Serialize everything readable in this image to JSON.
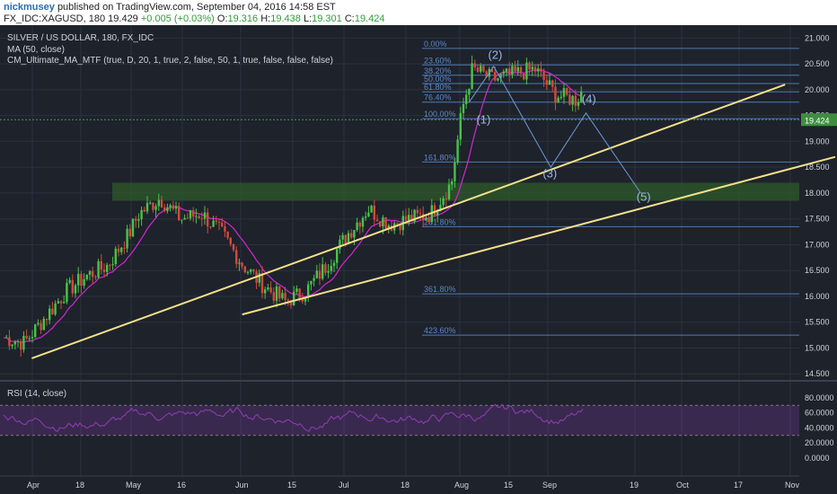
{
  "header": {
    "username": "nickmusey",
    "published": "published on TradingView.com, September 04, 2016 14:58 EST",
    "symbol": "FX_IDC:XAGUSD, 180",
    "last": "19.429",
    "change": "+0.005 (+0.03%)",
    "open_label": "O:",
    "open": "19.316",
    "high_label": "H:",
    "high": "19.438",
    "low_label": "L:",
    "low": "19.301",
    "close_label": "C:",
    "close": "19.424"
  },
  "legend": {
    "title": "SILVER / US DOLLAR, 180, FX_IDC",
    "ma": "MA (50, close)",
    "cm": "CM_Ultimate_MA_MTF (true, D, 20, 1, true, 2, false, 50, 1, true, false, false, false)",
    "rsi": "RSI (14, close)"
  },
  "colors": {
    "background": "#1e222b",
    "grid": "#2b3140",
    "candle_up": "#49c249",
    "candle_down": "#d24a3c",
    "ma": "#d028d0",
    "fib": "#5b89c7",
    "trendline": "#f3e08a",
    "support_zone": "#2d5a2a",
    "rsi": "#8e3fb8",
    "price_badge": "#3d8f3f"
  },
  "chart_data": {
    "type": "candlestick",
    "x_ticks": [
      "Apr",
      "18",
      "May",
      "16",
      "Jun",
      "15",
      "Jul",
      "18",
      "Aug",
      "15",
      "Sep",
      "19",
      "Oct",
      "17",
      "Nov"
    ],
    "y_ticks": [
      "21.000",
      "20.500",
      "20.000",
      "19.500",
      "19.000",
      "18.500",
      "18.000",
      "17.500",
      "17.000",
      "16.500",
      "16.000",
      "15.500",
      "15.000",
      "14.500"
    ],
    "ylim": [
      14.4,
      21.25
    ],
    "current_price": "19.424",
    "rsi_ticks": [
      "80.0000",
      "60.0000",
      "40.0000",
      "20.0000",
      "0.0000"
    ],
    "rsi_range": [
      0,
      100
    ],
    "rsi_bands": [
      70,
      30
    ],
    "support_zone": [
      17.85,
      18.2
    ],
    "price_path": [
      [
        0,
        15.2
      ],
      [
        2,
        15.1
      ],
      [
        4,
        15.6
      ],
      [
        6,
        16.1
      ],
      [
        8,
        16.4
      ],
      [
        10,
        16.6
      ],
      [
        12,
        17.2
      ],
      [
        13,
        17.6
      ],
      [
        15,
        17.9
      ],
      [
        17,
        17.5
      ],
      [
        19,
        17.6
      ],
      [
        21,
        17.2
      ],
      [
        23,
        16.6
      ],
      [
        25,
        16.2
      ],
      [
        27,
        15.9
      ],
      [
        29,
        16.1
      ],
      [
        31,
        16.6
      ],
      [
        33,
        17.2
      ],
      [
        35,
        17.7
      ],
      [
        37,
        17.4
      ],
      [
        39,
        17.5
      ],
      [
        41,
        17.6
      ],
      [
        43,
        18.2
      ],
      [
        44,
        19.6
      ],
      [
        45,
        20.4
      ],
      [
        47,
        20.2
      ],
      [
        49,
        20.3
      ],
      [
        51,
        20.4
      ],
      [
        53,
        19.9
      ],
      [
        55,
        19.8
      ],
      [
        57,
        20.5
      ],
      [
        59,
        20.7
      ],
      [
        61,
        20.4
      ],
      [
        63,
        20.1
      ],
      [
        65,
        19.6
      ],
      [
        67,
        19.2
      ],
      [
        69,
        18.7
      ],
      [
        71,
        18.6
      ],
      [
        73,
        18.8
      ],
      [
        74,
        19.2
      ],
      [
        75,
        19.42
      ]
    ],
    "fib_levels": [
      {
        "label": "0.00%",
        "value": 20.8
      },
      {
        "label": "23.60%",
        "value": 20.48
      },
      {
        "label": "38.20%",
        "value": 20.28
      },
      {
        "label": "50.00%",
        "value": 20.12
      },
      {
        "label": "61.80%",
        "value": 19.96
      },
      {
        "label": "76.40%",
        "value": 19.76
      },
      {
        "label": "100.00%",
        "value": 19.44
      },
      {
        "label": "161.80%",
        "value": 18.6
      },
      {
        "label": "261.80%",
        "value": 17.35
      },
      {
        "label": "361.80%",
        "value": 16.05
      },
      {
        "label": "423.60%",
        "value": 15.25
      }
    ],
    "wave_labels": [
      {
        "label": "(1)",
        "x": 62,
        "y": 19.35
      },
      {
        "label": "(2)",
        "x": 63.5,
        "y": 20.6
      },
      {
        "label": "(3)",
        "x": 70.5,
        "y": 18.3
      },
      {
        "label": "(4)",
        "x": 75.5,
        "y": 19.75
      },
      {
        "label": "(5)",
        "x": 82.5,
        "y": 17.85
      }
    ],
    "wave_path": [
      [
        60,
        19.75
      ],
      [
        63.2,
        20.45
      ],
      [
        70.5,
        18.5
      ],
      [
        75.0,
        19.55
      ],
      [
        82,
        18.0
      ]
    ],
    "trendlines": [
      {
        "from": [
          3.8,
          14.8
        ],
        "to": [
          94,
          20.1
        ]
      },
      {
        "from": [
          29,
          15.65
        ],
        "to": [
          100,
          18.7
        ]
      }
    ]
  }
}
